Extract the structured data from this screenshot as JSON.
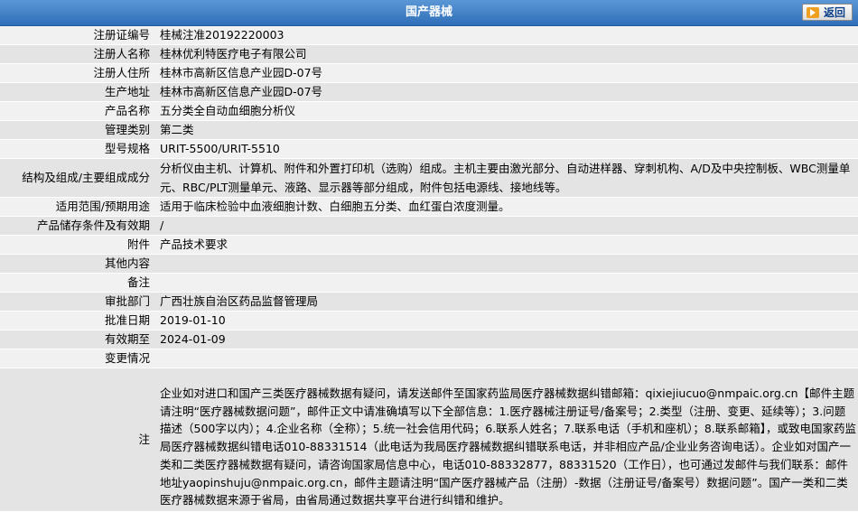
{
  "header": {
    "title": "国产器械",
    "back_label": "返回"
  },
  "fields": {
    "reg_no": {
      "label": "注册证编号",
      "value": "桂械注准20192220003"
    },
    "registrant_name": {
      "label": "注册人名称",
      "value": "桂林优利特医疗电子有限公司"
    },
    "registrant_address": {
      "label": "注册人住所",
      "value": "桂林市高新区信息产业园D-07号"
    },
    "production_address": {
      "label": "生产地址",
      "value": "桂林市高新区信息产业园D-07号"
    },
    "product_name": {
      "label": "产品名称",
      "value": "五分类全自动血细胞分析仪"
    },
    "category": {
      "label": "管理类别",
      "value": "第二类"
    },
    "model": {
      "label": "型号规格",
      "value": "URIT-5500/URIT-5510"
    },
    "structure": {
      "label": "结构及组成/主要组成成分",
      "value": "分析仪由主机、计算机、附件和外置打印机（选购）组成。主机主要由激光部分、自动进样器、穿刺机构、A/D及中央控制板、WBC测量单元、RBC/PLT测量单元、液路、显示器等部分组成，附件包括电源线、接地线等。"
    },
    "scope": {
      "label": "适用范围/预期用途",
      "value": "适用于临床检验中血液细胞计数、白细胞五分类、血红蛋白浓度测量。"
    },
    "storage": {
      "label": "产品储存条件及有效期",
      "value": "/"
    },
    "attachment": {
      "label": "附件",
      "value": "产品技术要求"
    },
    "other": {
      "label": "其他内容",
      "value": ""
    },
    "remark": {
      "label": "备注",
      "value": ""
    },
    "dept": {
      "label": "审批部门",
      "value": "广西壮族自治区药品监督管理局"
    },
    "approve_date": {
      "label": "批准日期",
      "value": "2019-01-10"
    },
    "expire_date": {
      "label": "有效期至",
      "value": "2024-01-09"
    },
    "changes": {
      "label": "变更情况",
      "value": ""
    }
  },
  "note": {
    "label": "注",
    "text": "企业如对进口和国产三类医疗器械数据有疑问，请发送邮件至国家药监局医疗器械数据纠错邮箱：qixiejiucuo@nmpaic.org.cn【邮件主题请注明“医疗器械数据问题”，邮件正文中请准确填写以下全部信息：1.医疗器械注册证号/备案号；2.类型（注册、变更、延续等）；3.问题描述（500字以内）；4.企业名称（全称）；5.统一社会信用代码；6.联系人姓名；7.联系电话（手机和座机）；8.联系邮箱】，或致电国家药监局医疗器械数据纠错电话010-88331514（此电话为我局医疗器械数据纠错联系电话，并非相应产品/企业业务咨询电话）。企业如对国产一类和二类医疗器械数据有疑问，请咨询国家局信息中心，电话010-88332877，88331520（工作日），也可通过发邮件与我们联系：邮件地址yaopinshuju@nmpaic.org.cn，邮件主题请注明“国产医疗器械产品（注册）-数据（注册证号/备案号）数据问题”。国产一类和二类医疗器械数据来源于省局，由省局通过数据共享平台进行纠错和维护。"
  }
}
